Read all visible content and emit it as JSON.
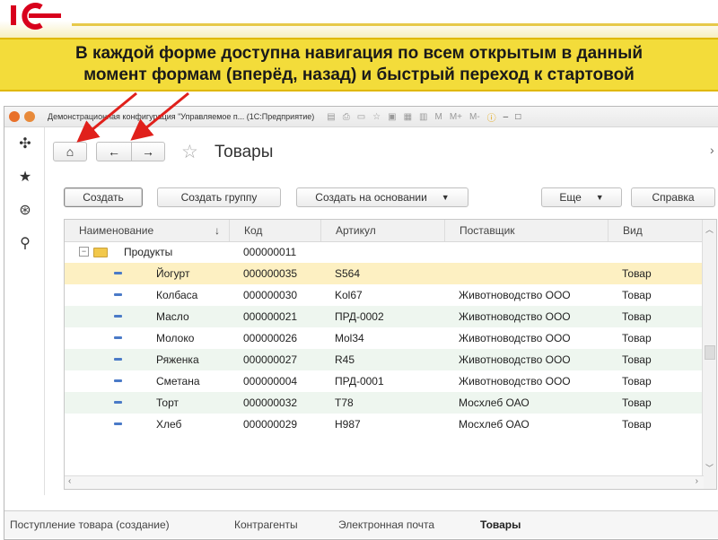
{
  "slide": {
    "logo_text": "1С",
    "banner_line1": "В каждой форме доступна навигация по всем открытым в данный",
    "banner_line2": "момент формам (вперёд, назад) и быстрый переход к стартовой",
    "accent_color": "#f3dc3a",
    "arrow_color": "#e0201b"
  },
  "window": {
    "title": "Демонстрационная конфигурация \"Управляемое п... (1С:Предприятие)",
    "toolbar_labels": [
      "M",
      "M+",
      "M-"
    ]
  },
  "sidebar": {
    "icons": [
      "main-menu-icon",
      "favorites-star-icon",
      "history-icon",
      "search-icon"
    ]
  },
  "form": {
    "title": "Товары",
    "nav": {
      "home_icon": "home-icon",
      "back_icon": "back-arrow-icon",
      "forward_icon": "forward-arrow-icon"
    },
    "collapse_symbol": "›",
    "buttons": {
      "create": "Создать",
      "create_group": "Создать группу",
      "create_based_on": "Создать на основании",
      "more": "Еще",
      "help": "Справка"
    }
  },
  "grid": {
    "columns": [
      "Наименование",
      "Код",
      "Артикул",
      "Поставщик",
      "Вид"
    ],
    "sort_indicator": "↓",
    "group_row": {
      "name": "Продукты",
      "code": "000000011"
    },
    "rows": [
      {
        "name": "Йогурт",
        "code": "000000035",
        "article": "S564",
        "supplier": "",
        "kind": "Товар"
      },
      {
        "name": "Колбаса",
        "code": "000000030",
        "article": "Kol67",
        "supplier": "Животноводство ООО",
        "kind": "Товар"
      },
      {
        "name": "Масло",
        "code": "000000021",
        "article": "ПРД-0002",
        "supplier": "Животноводство ООО",
        "kind": "Товар"
      },
      {
        "name": "Молоко",
        "code": "000000026",
        "article": "Mol34",
        "supplier": "Животноводство ООО",
        "kind": "Товар"
      },
      {
        "name": "Ряженка",
        "code": "000000027",
        "article": "R45",
        "supplier": "Животноводство ООО",
        "kind": "Товар"
      },
      {
        "name": "Сметана",
        "code": "000000004",
        "article": "ПРД-0001",
        "supplier": "Животноводство ООО",
        "kind": "Товар"
      },
      {
        "name": "Торт",
        "code": "000000032",
        "article": "T78",
        "supplier": "Мосхлеб ОАО",
        "kind": "Товар"
      },
      {
        "name": "Хлеб",
        "code": "000000029",
        "article": "H987",
        "supplier": "Мосхлеб ОАО",
        "kind": "Товар"
      }
    ]
  },
  "tabs": [
    {
      "label": "Поступление товара (создание)",
      "active": false
    },
    {
      "label": "Контрагенты",
      "active": false
    },
    {
      "label": "Электронная почта",
      "active": false
    },
    {
      "label": "Товары",
      "active": true
    }
  ]
}
